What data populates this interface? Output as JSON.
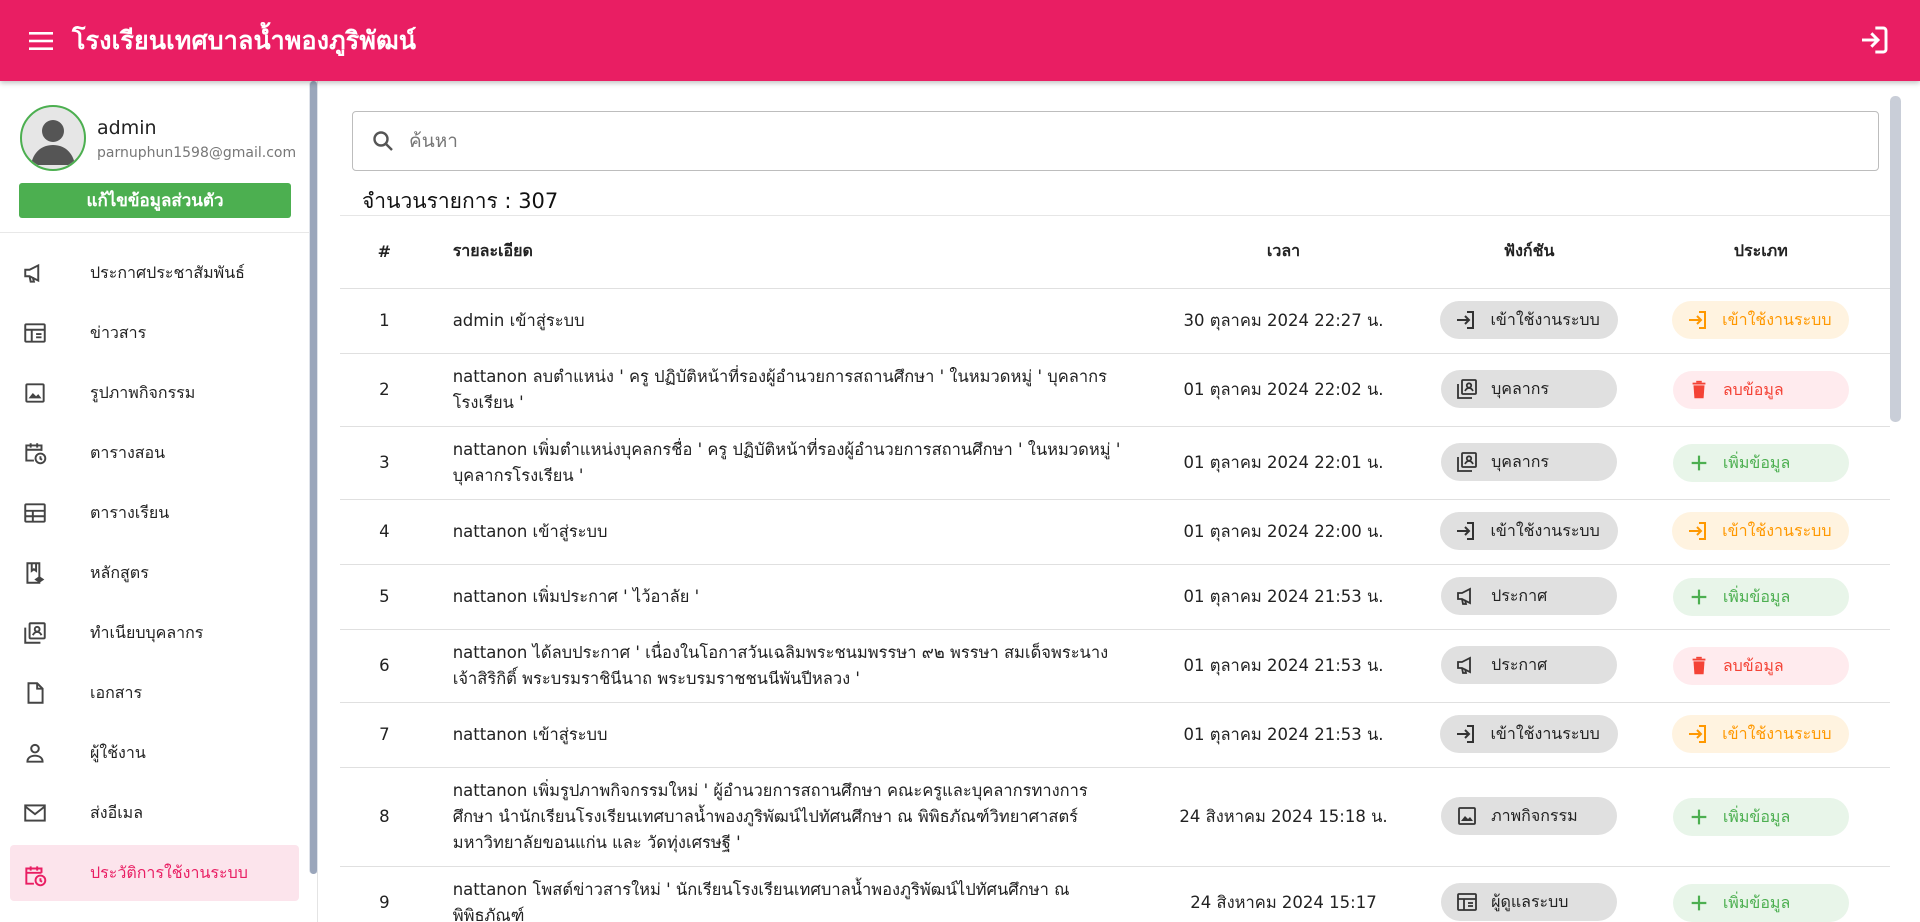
{
  "app": {
    "title": "โรงเรียนเทศบาลน้ำพองภูริพัฒน์"
  },
  "profile": {
    "name": "admin",
    "email": "parnuphun1598@gmail.com",
    "edit_label": "แก้ไขข้อมูลส่วนตัว"
  },
  "nav": [
    {
      "label": "ประกาศประชาสัมพันธ์",
      "icon": "megaphone-icon"
    },
    {
      "label": "ข่าวสาร",
      "icon": "newspaper-icon"
    },
    {
      "label": "รูปภาพกิจกรรม",
      "icon": "image-icon"
    },
    {
      "label": "ตารางสอน",
      "icon": "calendar-clock-icon"
    },
    {
      "label": "ตารางเรียน",
      "icon": "table-icon"
    },
    {
      "label": "หลักสูตร",
      "icon": "book-icon"
    },
    {
      "label": "ทำเนียบบุคลากร",
      "icon": "contacts-icon"
    },
    {
      "label": "เอกสาร",
      "icon": "file-icon"
    },
    {
      "label": "ผู้ใช้งาน",
      "icon": "user-icon"
    },
    {
      "label": "ส่งอีเมล",
      "icon": "mail-icon"
    },
    {
      "label": "ประวัติการใช้งานระบบ",
      "icon": "history-icon",
      "active": true
    }
  ],
  "search": {
    "placeholder": "ค้นหา"
  },
  "count": {
    "label": "จำนวนรายการ : 307"
  },
  "table": {
    "headers": {
      "num": "#",
      "detail": "รายละเอียด",
      "time": "เวลา",
      "func": "ฟังก์ชัน",
      "type": "ประเภท"
    },
    "rows": [
      {
        "num": "1",
        "detail": "admin เข้าสู่ระบบ",
        "time": "30 ตุลาคม 2024 22:27 น.",
        "func": "เข้าใช้งานระบบ",
        "func_icon": "login-icon",
        "type": "เข้าใช้งานระบบ",
        "type_kind": "login"
      },
      {
        "num": "2",
        "detail": "nattanon ลบตำแหน่ง ' ครู ปฏิบัติหน้าที่รองผู้อำนวยการสถานศึกษา ' ในหมวดหมู่ ' บุคลากรโรงเรียน '",
        "time": "01 ตุลาคม 2024 22:02 น.",
        "func": "บุคลากร",
        "func_icon": "contacts-icon",
        "type": "ลบข้อมูล",
        "type_kind": "delete"
      },
      {
        "num": "3",
        "detail": "nattanon เพิ่มตำแหน่งบุคลกรชื่อ ' ครู ปฏิบัติหน้าที่รองผู้อำนวยการสถานศึกษา ' ในหมวดหมู่ ' บุคลากรโรงเรียน '",
        "time": "01 ตุลาคม 2024 22:01 น.",
        "func": "บุคลากร",
        "func_icon": "contacts-icon",
        "type": "เพิ่มข้อมูล",
        "type_kind": "add"
      },
      {
        "num": "4",
        "detail": "nattanon เข้าสู่ระบบ",
        "time": "01 ตุลาคม 2024 22:00 น.",
        "func": "เข้าใช้งานระบบ",
        "func_icon": "login-icon",
        "type": "เข้าใช้งานระบบ",
        "type_kind": "login"
      },
      {
        "num": "5",
        "detail": "nattanon เพิ่มประกาศ ' ไว้อาลัย '",
        "time": "01 ตุลาคม 2024 21:53 น.",
        "func": "ประกาศ",
        "func_icon": "megaphone-icon",
        "type": "เพิ่มข้อมูล",
        "type_kind": "add"
      },
      {
        "num": "6",
        "detail": "nattanon ได้ลบประกาศ ' เนื่องในโอกาสวันเฉลิมพระชนมพรรษา ๙๒ พรรษา สมเด็จพระนางเจ้าสิริกิติ์ พระบรมราชินีนาถ พระบรมราชชนนีพันปีหลวง '",
        "time": "01 ตุลาคม 2024 21:53 น.",
        "func": "ประกาศ",
        "func_icon": "megaphone-icon",
        "type": "ลบข้อมูล",
        "type_kind": "delete"
      },
      {
        "num": "7",
        "detail": "nattanon เข้าสู่ระบบ",
        "time": "01 ตุลาคม 2024 21:53 น.",
        "func": "เข้าใช้งานระบบ",
        "func_icon": "login-icon",
        "type": "เข้าใช้งานระบบ",
        "type_kind": "login"
      },
      {
        "num": "8",
        "detail": "nattanon เพิ่มรูปภาพกิจกรรมใหม่ ' ผู้อำนวยการสถานศึกษา คณะครูและบุคลากรทางการศึกษา นำนักเรียนโรงเรียนเทศบาลน้ำพองภูริพัฒน์ไปทัศนศึกษา ณ พิพิธภัณฑ์วิทยาศาสตร์ มหาวิทยาลัยขอนแก่น และ วัดทุ่งเศรษฐี '",
        "time": "24 สิงหาคม 2024 15:18 น.",
        "func": "ภาพกิจกรรม",
        "func_icon": "image-icon",
        "type": "เพิ่มข้อมูล",
        "type_kind": "add"
      },
      {
        "num": "9",
        "detail": "nattanon โพสต์ข่าวสารใหม่ ' นักเรียนโรงเรียนเทศบาลน้ำพองภูริพัฒน์ไปทัศนศึกษา ณ พิพิธภัณฑ์",
        "time": "24 สิงหาคม 2024 15:17",
        "func": "ผู้ดูแลระบบ",
        "func_icon": "newspaper-icon",
        "type": "เพิ่มข้อมูล",
        "type_kind": "add"
      }
    ]
  },
  "colors": {
    "primary": "#e91e63",
    "green": "#4caf50",
    "orange": "#ff9800",
    "red": "#f44336"
  }
}
